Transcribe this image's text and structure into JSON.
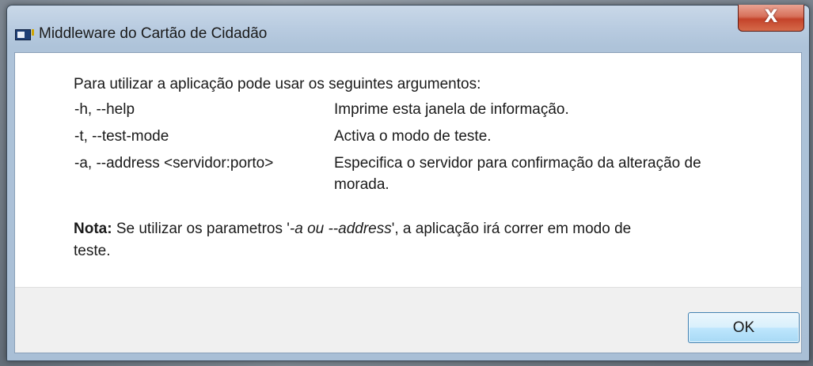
{
  "window": {
    "title": "Middleware do Cartão de Cidadão",
    "close_glyph": "X"
  },
  "icons": {
    "app": "app-window-icon",
    "close": "close-icon"
  },
  "content": {
    "intro": "Para utilizar a aplicação pode usar os seguintes argumentos:",
    "options": [
      {
        "flag": "-h, --help",
        "description": "Imprime esta janela de informação."
      },
      {
        "flag": "-t, --test-mode",
        "description": "Activa o modo de teste."
      },
      {
        "flag": "-a, --address <servidor:porto>",
        "description": "Especifica o servidor para confirmação da alteração de",
        "description_cont": "morada."
      }
    ],
    "note": {
      "label": "Nota:",
      "text_before": " Se utilizar os parametros '",
      "emphasis": "-a ou --address",
      "text_after": "', a aplicação irá correr em modo de",
      "cont": "teste."
    }
  },
  "footer": {
    "ok_label": "OK"
  },
  "colors": {
    "close_button": "#c4432a",
    "ok_button_border": "#3c7fb1",
    "footer_background": "#f0f0f0"
  }
}
